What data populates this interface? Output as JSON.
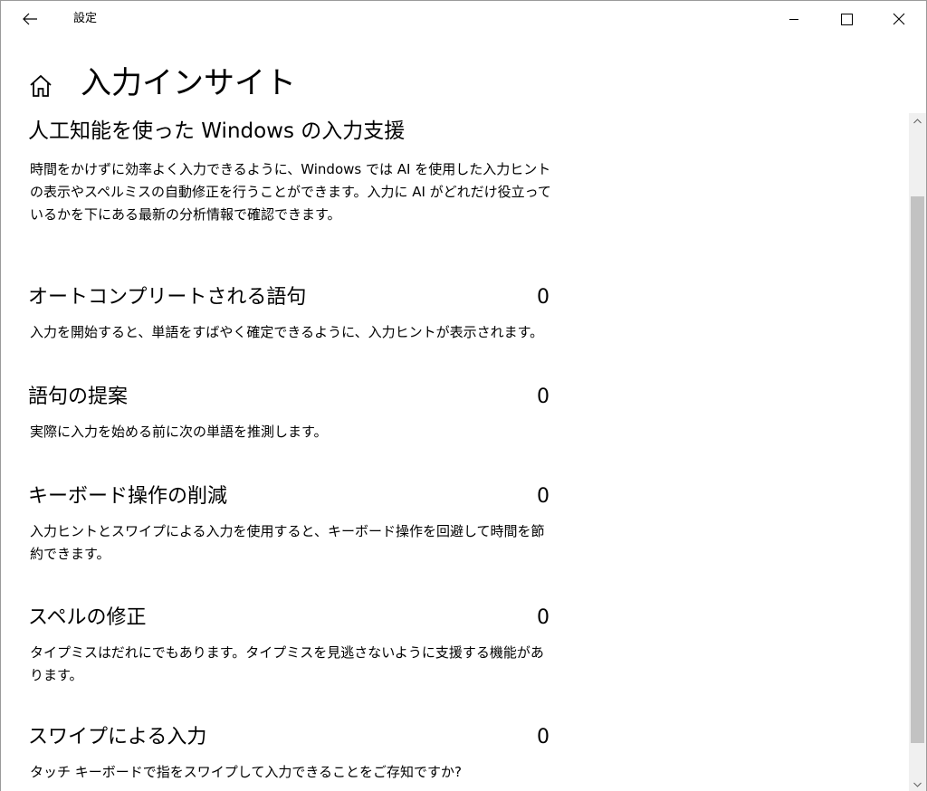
{
  "window": {
    "app_title": "設定"
  },
  "header": {
    "page_title": "入力インサイト"
  },
  "main": {
    "subheading": "人工知能を使った Windows の入力支援",
    "intro": "時間をかけずに効率よく入力できるように、Windows では AI を使用した入力ヒントの表示やスペルミスの自動修正を行うことができます。入力に AI がどれだけ役立っているかを下にある最新の分析情報で確認できます。",
    "stats": [
      {
        "label": "オートコンプリートされる語句",
        "value": "0",
        "description": "入力を開始すると、単語をすばやく確定できるように、入力ヒントが表示されます。"
      },
      {
        "label": "語句の提案",
        "value": "0",
        "description": "実際に入力を始める前に次の単語を推測します。"
      },
      {
        "label": "キーボード操作の削減",
        "value": "0",
        "description": "入力ヒントとスワイプによる入力を使用すると、キーボード操作を回避して時間を節約できます。"
      },
      {
        "label": "スペルの修正",
        "value": "0",
        "description": "タイプミスはだれにでもあります。タイプミスを見逃さないように支援する機能があります。"
      },
      {
        "label": "スワイプによる入力",
        "value": "0",
        "description": "タッチ キーボードで指をスワイプして入力できることをご存知ですか?"
      }
    ]
  },
  "icons": {
    "back": "back-arrow-icon",
    "home": "home-icon",
    "minimize": "minimize-icon",
    "maximize": "maximize-icon",
    "close": "close-icon"
  },
  "colors": {
    "scroll_thumb": "#c2c2c2",
    "scroll_track": "#f0f0f0"
  }
}
